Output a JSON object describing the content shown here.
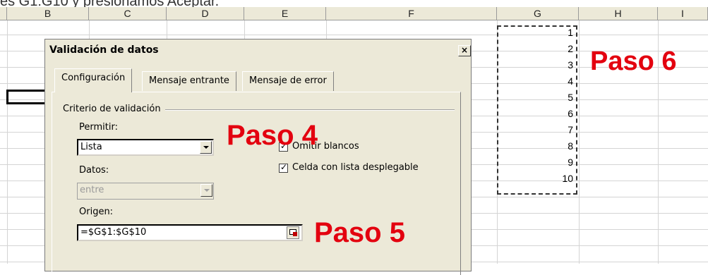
{
  "caption": "es G1:G10 y presionamos Aceptar.",
  "columns": [
    "B",
    "C",
    "D",
    "E",
    "F",
    "G",
    "H",
    "I"
  ],
  "cells_g": [
    "1",
    "2",
    "3",
    "4",
    "5",
    "6",
    "7",
    "8",
    "9",
    "10"
  ],
  "dialog": {
    "title": "Validación de datos",
    "close": "×",
    "tabs": [
      "Configuración",
      "Mensaje entrante",
      "Mensaje de error"
    ],
    "group_label": "Criterio de validación",
    "allow_label": "Permitir:",
    "allow_value": "Lista",
    "data_label": "Datos:",
    "data_value": "entre",
    "ignore_blank_label": "Omitir blancos",
    "dropdown_label": "Celda con lista desplegable",
    "source_label": "Origen:",
    "source_value": "=$G$1:$G$10"
  },
  "annotations": {
    "paso4": "Paso 4",
    "paso5": "Paso 5",
    "paso6": "Paso 6"
  },
  "colors": {
    "annotation": "#e3000f",
    "dialog_bg": "#ece9d8"
  }
}
